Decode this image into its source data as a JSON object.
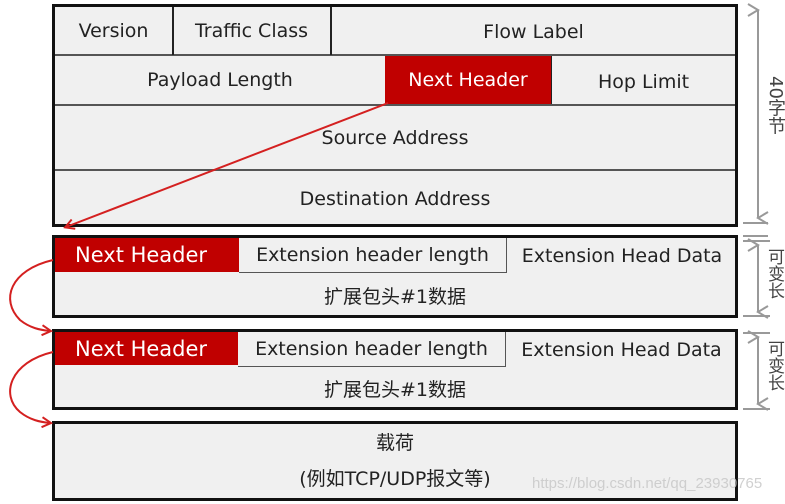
{
  "ipv6_header": {
    "row1": {
      "version": "Version",
      "traffic_class": "Traffic Class",
      "flow_label": "Flow Label"
    },
    "row2": {
      "payload_length": "Payload Length",
      "next_header": "Next Header",
      "hop_limit": "Hop Limit"
    },
    "source_address": "Source Address",
    "destination_address": "Destination Address",
    "size_label": "40字节"
  },
  "extension_headers": [
    {
      "next_header": "Next Header",
      "header_length": "Extension header length",
      "head_data": "Extension Head Data",
      "data_label": "扩展包头#1数据",
      "size_label": "可变长"
    },
    {
      "next_header": "Next Header",
      "header_length": "Extension header length",
      "head_data": "Extension Head Data",
      "data_label": "扩展包头#1数据",
      "size_label": "可变长"
    }
  ],
  "payload": {
    "title": "载荷",
    "subtitle": "(例如TCP/UDP报文等)"
  },
  "colors": {
    "highlight": "#c00000",
    "box_fill": "#f0f0f0",
    "border": "#111111",
    "arrow": "#d42020",
    "annotation": "#888888"
  },
  "watermark": "https://blog.csdn.net/qq_23930765"
}
